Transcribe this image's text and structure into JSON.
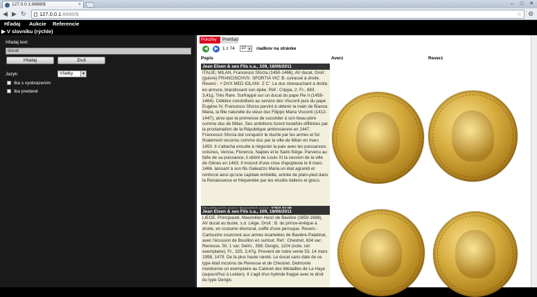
{
  "browser": {
    "tab_title": "127.0.0.1:8888/$",
    "url_host": "127.0.0.1",
    "url_rest": ":8888/$",
    "window_controls": [
      "–",
      "□",
      "✕"
    ]
  },
  "menu": {
    "items": [
      "Hľadaj",
      "Aukcie",
      "Referencie"
    ],
    "section_header": "▶ V slovníku (rýchle)"
  },
  "search": {
    "label": "Hľadaj text:",
    "value": "ducat",
    "search_button": "Hľadaj",
    "clear_button": "Zruš",
    "language_label": "Jazyk:",
    "language_value": "Všetky",
    "checkbox_images": "Iba s vyobrazením",
    "checkbox_sold": "Iba predané"
  },
  "results": {
    "tabs": [
      "Položky",
      "Prehľad"
    ],
    "active_tab": 0,
    "page_current": "1 z 74",
    "per_page": "10",
    "per_page_label": "riadkov na stránke",
    "columns": [
      "Popis",
      "Averz",
      "Reverz"
    ],
    "listings": [
      {
        "title": "Jean Elsen & ses Fils s.a., 109, 18/06/2011",
        "description": "ITALIE, MILAN, Francesco Sforza (1450-1466), AV ducat, Droit : (guivre) FRANCISCHVS· SFORTIA VIC' B. cuirassé à droite. Revers : + DVX MED·IOLANI· Z C'· Le duc chevauchant à droite, en armure, brandissant son épée. Réf.: Crippa, 2; Fr., 683. 3,41g. Très Rare. Surfrappé sur un ducat du pape Pie II (1458-1464). Célèbre condottiere au service des Visconti puis du pape Eugène IV, Francesco Sforza parvint à obtenir la main de Bianca Maria, la fille naturelle du vieux duc Filippo Maria Visconti (1412-1447), ainsi que la promesse de succéder à son beau-père comme duc de Milan. Ses ambitions furent toutefois différées par la proclamation de la République ambrosienne en 1447. Francesco Sforza dut conquérir le duché par les armes et fut finalement reconnu comme duc par la ville de Milan en mars 1450. Il s'attacha ensuite à négocier la paix avec les puissances voisines, Venise, Florence, Naples et le Saint-Siège. Parvenu au faîte de sa puissance, il obtint de Louis XI la cession de la ville de Gênes en 1463. Il mourut d'une crise d'apoplexie le 8 mars 1466, laissant à son fils Galeazzo Maria un état agrandi et renforcé ainsi qu'une capitale embellie, entrée de plain-pied dans la Renaissance et fréquentée par les érudits italiens et grecs.",
        "price_label": "Vyvolávacia cena: Konečná cena:",
        "price_value": "3750 EUR"
      },
      {
        "title": "Jean Elsen & ses Fils s.a., 109, 18/06/2011",
        "description": "LIEGE, Principauté, Maximilien Henri de Bavière (1650-1688), AV ducat au buste, s.d. Liège. Droit : B. du prince-évêque à droite, en costume électoral, coiffé d'une perruque. Revers : Cartouche couronné aux armes écartelées de Bavière-Palatinat, avec l'écusson de Bouillon en surtout. Ref.: Chestret, 634 var; Renesse, 50, 1 var; Delm., 358; Dengis, 1104 (note, cet exemplaire); Fr., 325. 3,47g. Provient de notre vente 53, 14 mars 1998, 1479. De la plus haute rareté. Le ducat sans date de ce type était inconnu de Renesse et de Chestret. Delmonte mentionne un exemplaire au Cabinet des Médailles de La Haye (aujourd'hui à Leiden). Il s'agit d'un hybride frappé avec le droit du type Dengis"
      }
    ]
  }
}
